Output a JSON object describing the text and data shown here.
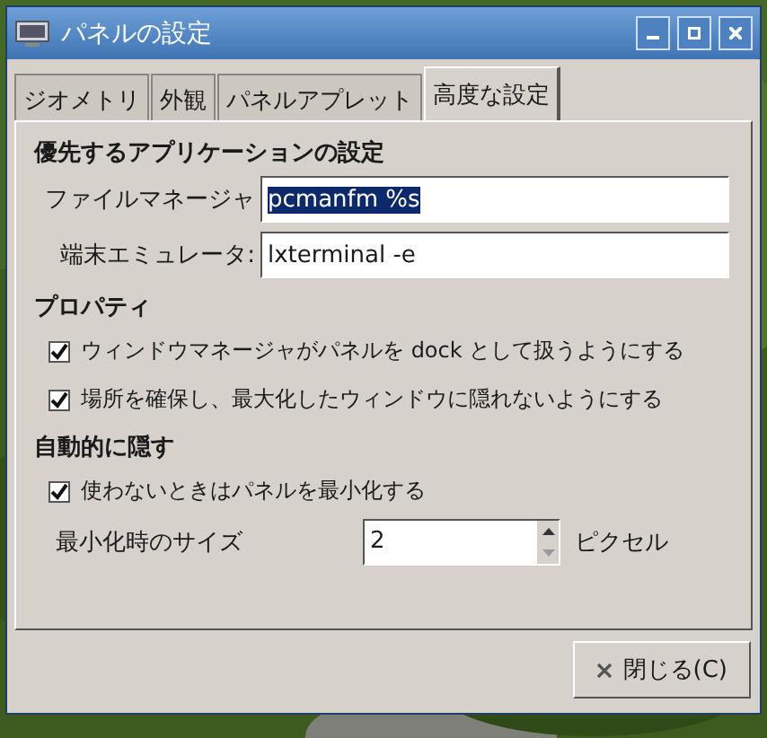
{
  "window": {
    "title": "パネルの設定"
  },
  "tabs": [
    {
      "label": "ジオメトリ",
      "selected": false
    },
    {
      "label": "外観",
      "selected": false
    },
    {
      "label": "パネルアプレット",
      "selected": false
    },
    {
      "label": "高度な設定",
      "selected": true
    }
  ],
  "preferred_apps": {
    "heading": "優先するアプリケーションの設定",
    "fields": [
      {
        "label": "ファイルマネージャ",
        "value": "pcmanfm %s",
        "selected": true
      },
      {
        "label": "端末エミュレータ:",
        "value": "lxterminal -e",
        "selected": false
      }
    ]
  },
  "properties": {
    "heading": "プロパティ",
    "options": [
      {
        "label": "ウィンドウマネージャがパネルを dock として扱うようにする",
        "checked": true
      },
      {
        "label": "場所を確保し、最大化したウィンドウに隠れないようにする",
        "checked": true
      }
    ]
  },
  "autohide": {
    "heading": "自動的に隠す",
    "options": [
      {
        "label": "使わないときはパネルを最小化する",
        "checked": true
      }
    ],
    "size": {
      "label": "最小化時のサイズ",
      "value": "2",
      "unit": "ピクセル"
    }
  },
  "buttons": [
    {
      "label": "閉じる(C)"
    }
  ]
}
